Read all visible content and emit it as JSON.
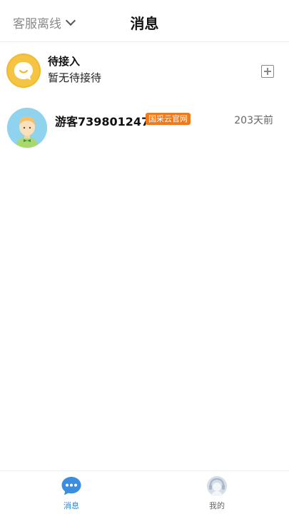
{
  "header": {
    "service_status": "客服离线",
    "title": "消息"
  },
  "pending": {
    "title": "待接入",
    "subtitle": "暂无待接待"
  },
  "conversations": [
    {
      "name": "游客739801247",
      "source_badge": "国采云官网",
      "time": "203天前"
    }
  ],
  "tabbar": {
    "items": [
      {
        "label": "消息",
        "active": true
      },
      {
        "label": "我的",
        "active": false
      }
    ]
  },
  "colors": {
    "accent": "#2e84d9",
    "badge": "#ee7a1d",
    "pending_avatar": "#f6c443",
    "visitor_avatar_bg": "#8fd3ee"
  }
}
